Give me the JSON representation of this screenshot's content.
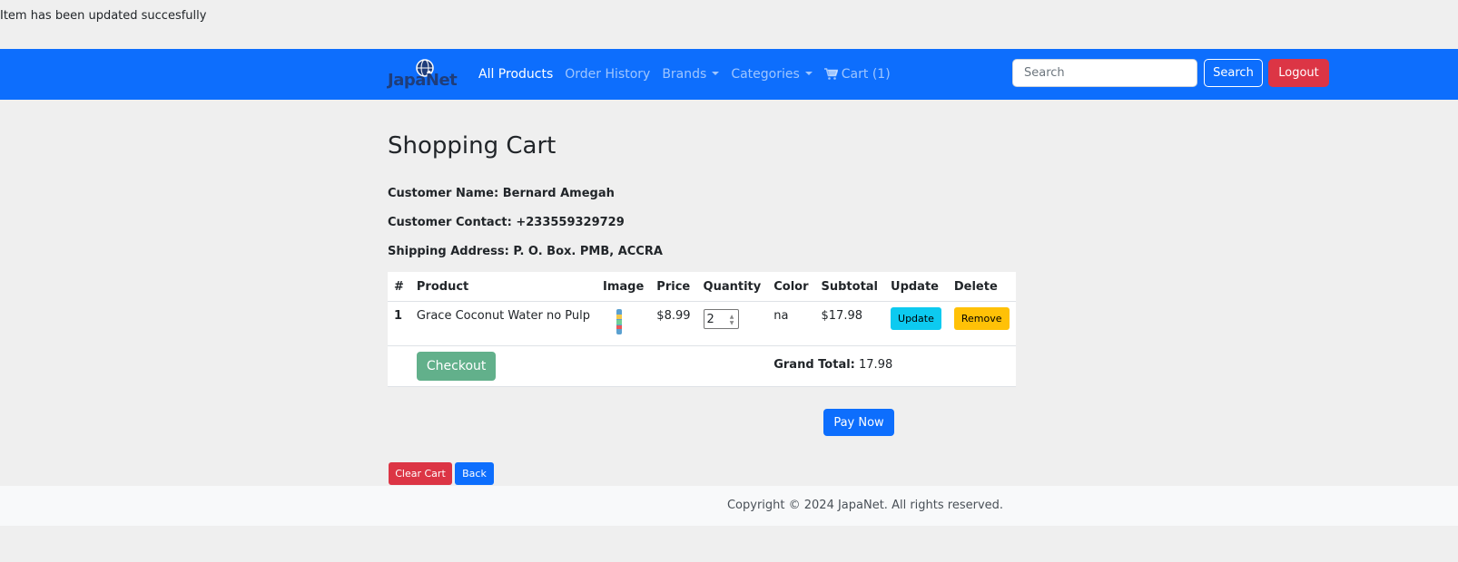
{
  "flash": {
    "message": "Item has been updated succesfully"
  },
  "nav": {
    "brand": "JapaNet",
    "links": [
      {
        "label": "All Products"
      },
      {
        "label": "Order History"
      },
      {
        "label": "Brands"
      },
      {
        "label": "Categories"
      },
      {
        "label": "Cart (1)"
      }
    ],
    "search": {
      "placeholder": "Search",
      "value": "",
      "button": "Search"
    },
    "logout": "Logout",
    "colors": {
      "navbar": "#0d6efd",
      "logout": "#dc3545"
    }
  },
  "page": {
    "title": "Shopping Cart",
    "customer": {
      "name": "Customer Name: Bernard Amegah",
      "contact": "Customer Contact: +233559329729",
      "address": "Shipping Address: P. O. Box. PMB, ACCRA"
    }
  },
  "table": {
    "headers": [
      "#",
      "Product",
      "Image",
      "Price",
      "Quantity",
      "Color",
      "Subtotal",
      "Update",
      "Delete"
    ],
    "rows": [
      {
        "num": "1",
        "product": "Grace Coconut Water no Pulp",
        "image_icon": "product-can-icon",
        "price": "$8.99",
        "quantity": "2",
        "color": "na",
        "subtotal": "$17.98",
        "update_label": "Update",
        "delete_label": "Remove"
      }
    ],
    "checkout_label": "Checkout",
    "grand_total_label": "Grand Total:",
    "grand_total_value": "17.98"
  },
  "actions": {
    "pay_now": "Pay Now",
    "clear_cart": "Clear Cart",
    "back": "Back"
  },
  "footer": {
    "text": "Copyright © 2024 JapaNet. All rights reserved."
  }
}
